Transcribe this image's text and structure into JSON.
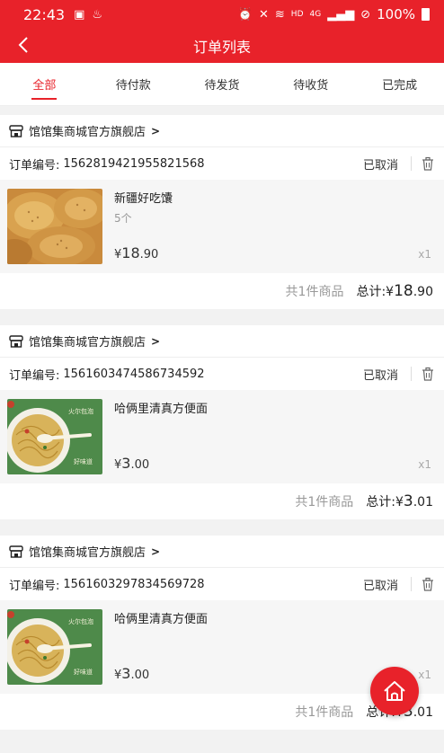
{
  "status_bar": {
    "time": "22:43",
    "battery": "100%",
    "network": "4G",
    "hd": "HD"
  },
  "nav": {
    "title": "订单列表"
  },
  "tabs": [
    {
      "label": "全部",
      "active": true
    },
    {
      "label": "待付款",
      "active": false
    },
    {
      "label": "待发货",
      "active": false
    },
    {
      "label": "待收货",
      "active": false
    },
    {
      "label": "已完成",
      "active": false
    }
  ],
  "orders": [
    {
      "shop_name": "馆馆集商城官方旗舰店",
      "order_no_label": "订单编号:",
      "order_no": "1562819421955821568",
      "status": "已取消",
      "product_name": "新疆好吃馕",
      "product_spec": "5个",
      "price_symbol": "¥",
      "price_int": "18",
      "price_dec": ".90",
      "qty": "x1",
      "count_text": "共1件商品",
      "total_label": "总计:",
      "total_symbol": "¥",
      "total_int": "18",
      "total_dec": ".90"
    },
    {
      "shop_name": "馆馆集商城官方旗舰店",
      "order_no_label": "订单编号:",
      "order_no": "1561603474586734592",
      "status": "已取消",
      "product_name": "哈俩里清真方便面",
      "product_spec": "",
      "price_symbol": "¥",
      "price_int": "3",
      "price_dec": ".00",
      "qty": "x1",
      "count_text": "共1件商品",
      "total_label": "总计:",
      "total_symbol": "¥",
      "total_int": "3",
      "total_dec": ".01"
    },
    {
      "shop_name": "馆馆集商城官方旗舰店",
      "order_no_label": "订单编号:",
      "order_no": "1561603297834569728",
      "status": "已取消",
      "product_name": "哈俩里清真方便面",
      "product_spec": "",
      "price_symbol": "¥",
      "price_int": "3",
      "price_dec": ".00",
      "qty": "x1",
      "count_text": "共1件商品",
      "total_label": "总计:",
      "total_symbol": "¥",
      "total_int": "3",
      "total_dec": ".01"
    }
  ],
  "noodle_thumb_text": {
    "top": "火尔包泡",
    "bottom": "好味道"
  },
  "colors": {
    "brand": "#e8222a"
  }
}
